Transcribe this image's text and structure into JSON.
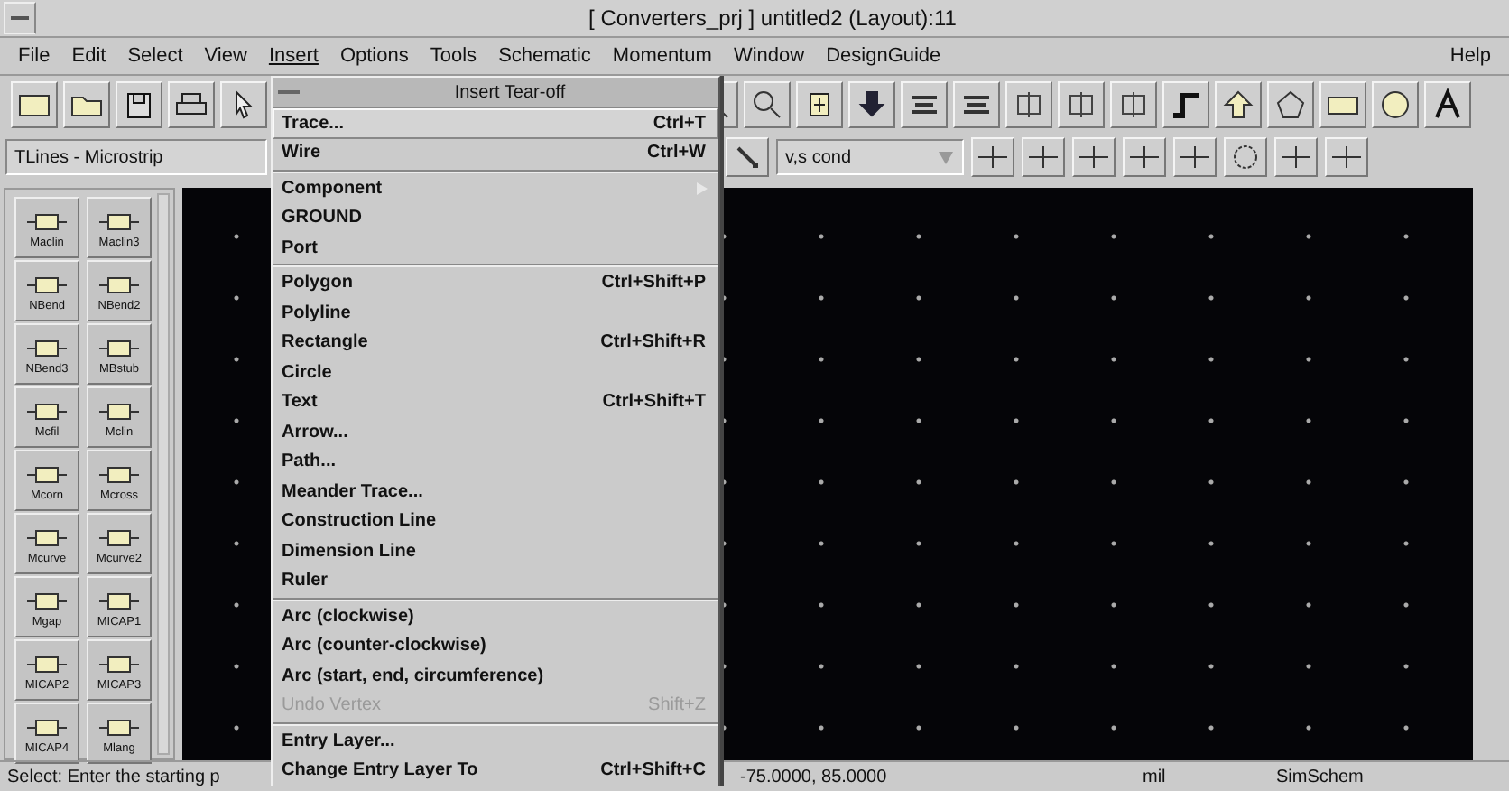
{
  "window": {
    "title": "[ Converters_prj ] untitled2 (Layout):11"
  },
  "menu_bar": [
    {
      "label": "File",
      "selected": false
    },
    {
      "label": "Edit",
      "selected": false
    },
    {
      "label": "Select",
      "selected": false
    },
    {
      "label": "View",
      "selected": false
    },
    {
      "label": "Insert",
      "selected": true
    },
    {
      "label": "Options",
      "selected": false
    },
    {
      "label": "Tools",
      "selected": false
    },
    {
      "label": "Schematic",
      "selected": false
    },
    {
      "label": "Momentum",
      "selected": false
    },
    {
      "label": "Window",
      "selected": false
    },
    {
      "label": "DesignGuide",
      "selected": false
    }
  ],
  "help_menu": "Help",
  "palette_selector": {
    "value": "TLines - Microstrip"
  },
  "layer_selector": {
    "value": "v,s cond"
  },
  "palette": [
    {
      "label": "Maclin"
    },
    {
      "label": "Maclin3"
    },
    {
      "label": "NBend"
    },
    {
      "label": "NBend2"
    },
    {
      "label": "NBend3"
    },
    {
      "label": "MBstub"
    },
    {
      "label": "Mcfil"
    },
    {
      "label": "Mclin"
    },
    {
      "label": "Mcorn"
    },
    {
      "label": "Mcross"
    },
    {
      "label": "Mcurve"
    },
    {
      "label": "Mcurve2"
    },
    {
      "label": "Mgap"
    },
    {
      "label": "MICAP1"
    },
    {
      "label": "MICAP2"
    },
    {
      "label": "MICAP3"
    },
    {
      "label": "MICAP4"
    },
    {
      "label": "Mlang"
    }
  ],
  "insert_menu": {
    "title": "Insert Tear-off",
    "groups": [
      [
        {
          "label": "Trace...",
          "shortcut": "Ctrl+T",
          "selected": true,
          "disabled": false,
          "kind": "item"
        },
        {
          "label": "Wire",
          "shortcut": "Ctrl+W",
          "selected": false,
          "disabled": false,
          "kind": "item"
        }
      ],
      [
        {
          "label": "Component",
          "selected": false,
          "disabled": false,
          "kind": "submenu"
        },
        {
          "label": "GROUND",
          "selected": false,
          "disabled": false,
          "kind": "item"
        },
        {
          "label": "Port",
          "selected": false,
          "disabled": false,
          "kind": "item"
        }
      ],
      [
        {
          "label": "Polygon",
          "shortcut": "Ctrl+Shift+P",
          "selected": false,
          "disabled": false,
          "kind": "item"
        },
        {
          "label": "Polyline",
          "selected": false,
          "disabled": false,
          "kind": "item"
        },
        {
          "label": "Rectangle",
          "shortcut": "Ctrl+Shift+R",
          "selected": false,
          "disabled": false,
          "kind": "item"
        },
        {
          "label": "Circle",
          "selected": false,
          "disabled": false,
          "kind": "item"
        },
        {
          "label": "Text",
          "shortcut": "Ctrl+Shift+T",
          "selected": false,
          "disabled": false,
          "kind": "item"
        },
        {
          "label": "Arrow...",
          "selected": false,
          "disabled": false,
          "kind": "item"
        },
        {
          "label": "Path...",
          "selected": false,
          "disabled": false,
          "kind": "item"
        },
        {
          "label": "Meander Trace...",
          "selected": false,
          "disabled": false,
          "kind": "item"
        },
        {
          "label": "Construction Line",
          "selected": false,
          "disabled": false,
          "kind": "item"
        },
        {
          "label": "Dimension Line",
          "selected": false,
          "disabled": false,
          "kind": "item"
        },
        {
          "label": "Ruler",
          "selected": false,
          "disabled": false,
          "kind": "item"
        }
      ],
      [
        {
          "label": "Arc (clockwise)",
          "selected": false,
          "disabled": false,
          "kind": "item"
        },
        {
          "label": "Arc (counter-clockwise)",
          "selected": false,
          "disabled": false,
          "kind": "item"
        },
        {
          "label": "Arc (start, end, circumference)",
          "selected": false,
          "disabled": false,
          "kind": "item"
        },
        {
          "label": "Undo Vertex",
          "shortcut": "Shift+Z",
          "selected": false,
          "disabled": true,
          "kind": "item"
        }
      ],
      [
        {
          "label": "Entry Layer...",
          "selected": false,
          "disabled": false,
          "kind": "item"
        },
        {
          "label": "Change Entry Layer To",
          "shortcut": "Ctrl+Shift+C",
          "selected": false,
          "disabled": false,
          "kind": "item"
        }
      ]
    ]
  },
  "status_bar": {
    "prompt": "Select: Enter the starting p",
    "coordinates": "-75.0000, 85.0000",
    "units": "mil",
    "mode": "SimSchem"
  }
}
